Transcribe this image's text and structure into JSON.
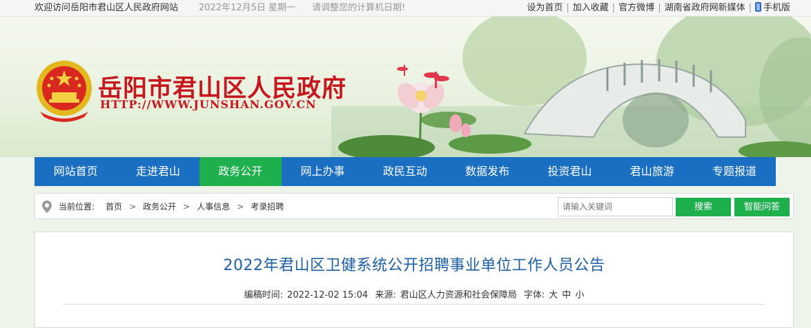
{
  "topbar": {
    "welcome": "欢迎访问岳阳市君山区人民政府网站",
    "date": "2022年12月5日 星期一",
    "tip": "请调整您的计算机日期!",
    "links": [
      "设为首页",
      "加入收藏",
      "官方微博",
      "湖南省政府网新媒体"
    ],
    "mobile": "手机版"
  },
  "header": {
    "title": "岳阳市君山区人民政府",
    "url": "HTTP://WWW.JUNSHAN.GOV.CN"
  },
  "nav": {
    "items": [
      "网站首页",
      "走进君山",
      "政务公开",
      "网上办事",
      "政民互动",
      "数据发布",
      "投资君山",
      "君山旅游",
      "专题报道"
    ],
    "active_index": 2
  },
  "location": {
    "label": "当前位置:",
    "crumbs": [
      "首页",
      "政务公开",
      "人事信息",
      "考录招聘"
    ]
  },
  "search": {
    "placeholder": "请输入关键词",
    "button": "搜索",
    "ai_button": "智能问答"
  },
  "article": {
    "title": "2022年君山区卫健系统公开招聘事业单位工作人员公告",
    "time_label": "编稿时间:",
    "time": "2022-12-02 15:04",
    "source_label": "来源:",
    "source": "君山区人力资源和社会保障局",
    "font_label": "字体:",
    "font_sizes": [
      "大",
      "中",
      "小"
    ]
  },
  "colors": {
    "nav": "#1a6fc2",
    "active": "#1db04c",
    "title_red": "#c8161e",
    "article_title": "#1a5fa8"
  }
}
